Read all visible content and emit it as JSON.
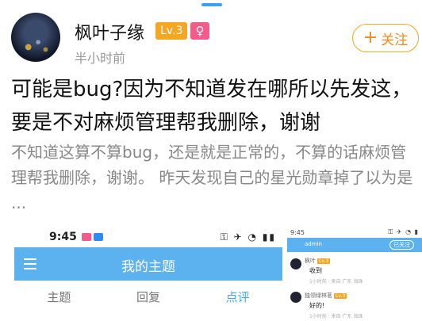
{
  "post": {
    "username": "枫叶子缘",
    "level": "Lv.3",
    "gender_symbol": "♀",
    "timestamp": "半小时前",
    "follow_label": "关注",
    "title": "可能是bug?因为不知道发在哪所以先发这，要是不对麻烦管理帮我删除，谢谢",
    "body": "不知道这算不算bug，还是就是正常的，不算的话麻烦管理帮我删除，谢谢。 昨天发现自己的星光勋章掉了以为是 ..."
  },
  "screenshot1": {
    "time": "9:45",
    "title": "我的主题",
    "tabs": [
      "主题",
      "回复",
      "点评"
    ],
    "active_tab": 2
  },
  "screenshot2": {
    "time": "9:45",
    "admin_name": "admin",
    "admin_button": "已关注",
    "reply1_name": "枫叶",
    "reply1_level": "Lv.3",
    "reply1_msg": "收到",
    "reply1_meta": "1小时前 · 来自 广东 海珠",
    "reply2_name": "独领绿林茗",
    "reply2_level": "Lv.3",
    "reply2_msg": "好的!",
    "reply2_meta": "1小时前 · 来自 广东 海珠"
  },
  "colors": {
    "accent_orange": "#f5a623",
    "accent_blue": "#5bb2ee",
    "gender_pink": "#f25b8a"
  }
}
